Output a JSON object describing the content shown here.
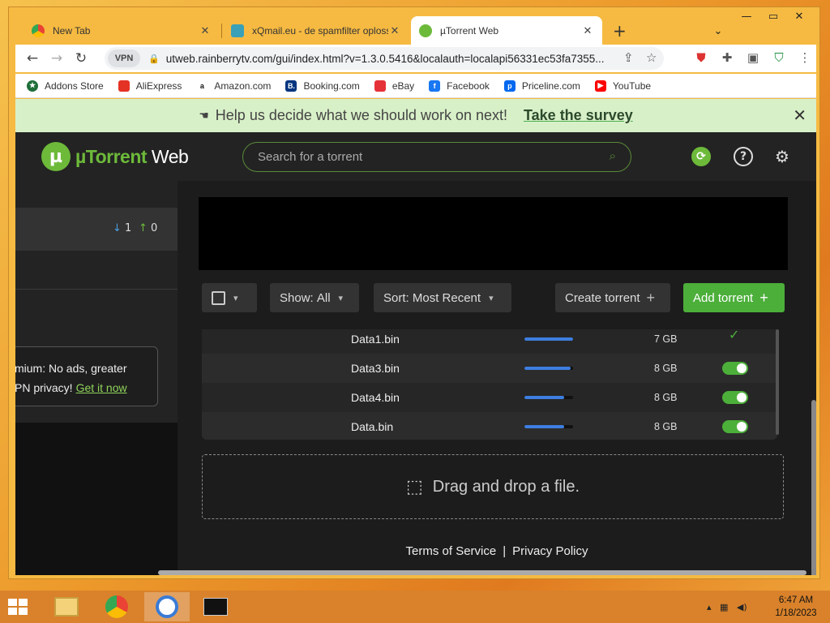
{
  "browser": {
    "tabs": [
      {
        "title": "New Tab",
        "icon": "chrome-icon"
      },
      {
        "title": "xQmail.eu - de spamfilter oploss",
        "icon": "xqmail-icon"
      },
      {
        "title": "µTorrent Web",
        "icon": "utorrent-icon",
        "active": true
      }
    ],
    "url": "utweb.rainberrytv.com/gui/index.html?v=1.3.0.5416&localauth=localapi56331ec53fa7355...",
    "vpn_label": "VPN",
    "bookmarks": [
      {
        "label": "Addons Store",
        "color": "#1e6e3a"
      },
      {
        "label": "AliExpress",
        "color": "#e43225"
      },
      {
        "label": "Amazon.com",
        "color": "#111111"
      },
      {
        "label": "Booking.com",
        "color": "#003580"
      },
      {
        "label": "eBay",
        "color": "#e53238"
      },
      {
        "label": "Facebook",
        "color": "#1877f2"
      },
      {
        "label": "Priceline.com",
        "color": "#0068ef"
      },
      {
        "label": "YouTube",
        "color": "#ff0000"
      }
    ]
  },
  "survey": {
    "text": "Help us decide what we should work on next!",
    "link": "Take the survey"
  },
  "app": {
    "logo_text_mu": "µTorrent",
    "logo_text_web": " Web",
    "search_placeholder": "Search for a torrent",
    "sidebar": {
      "download_count": "1",
      "upload_count": "0",
      "promo_line1": "mium: No ads, greater",
      "promo_line2": "PN privacy!",
      "promo_link": "Get it now"
    },
    "controls": {
      "show_label": "Show:",
      "show_value": "All",
      "sort_label": "Sort:",
      "sort_value": "Most Recent",
      "create_label": "Create torrent",
      "add_label": "Add torrent"
    },
    "torrents": [
      {
        "name": "Data1.bin",
        "progress": 1.0,
        "size": "7 GB",
        "status": "done"
      },
      {
        "name": "Data3.bin",
        "progress": 0.95,
        "size": "8 GB",
        "status": "on"
      },
      {
        "name": "Data4.bin",
        "progress": 0.82,
        "size": "8 GB",
        "status": "on"
      },
      {
        "name": "Data.bin",
        "progress": 0.82,
        "size": "8 GB",
        "status": "on"
      }
    ],
    "dropzone_text": "Drag and drop a file.",
    "footer": {
      "terms": "Terms of Service",
      "privacy": "Privacy Policy",
      "separator": "|"
    }
  },
  "taskbar": {
    "time": "6:47 AM",
    "date": "1/18/2023"
  },
  "colors": {
    "accent": "#4caf3a",
    "progress": "#3d7ee0"
  }
}
